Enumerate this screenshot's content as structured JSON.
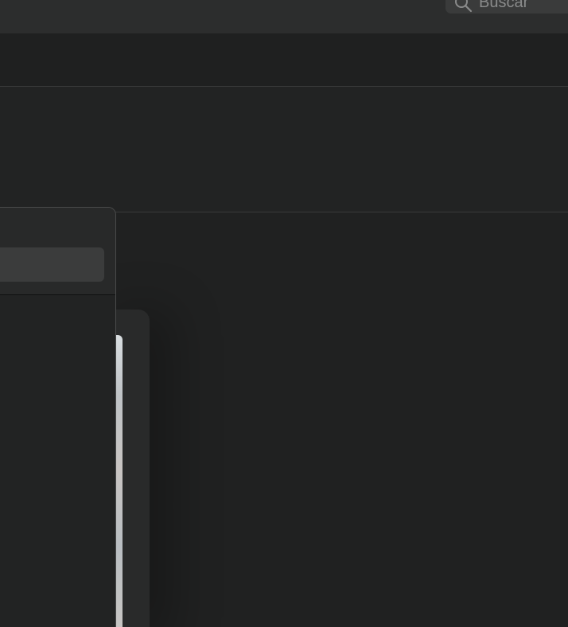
{
  "toolbar": {
    "search": {
      "placeholder": "Buscar",
      "icon": "search-icon"
    }
  },
  "colors": {
    "background": "#202121",
    "toolbar": "#2c2d2d",
    "divider": "#3a3b3b",
    "popover_border": "#4a4b4b"
  }
}
